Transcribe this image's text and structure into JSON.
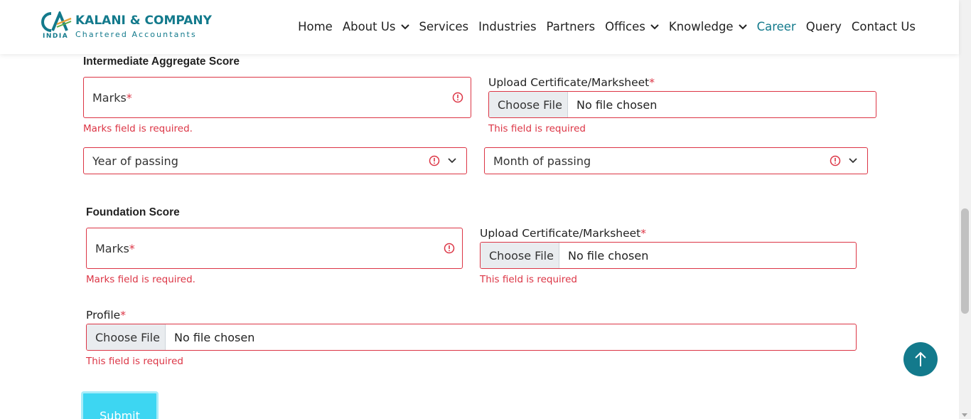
{
  "brand": {
    "company": "KALANI & COMPANY",
    "tagline": "Chartered Accountants",
    "country": "INDIA",
    "mark": "CA",
    "accent_color": "#137a8c"
  },
  "nav": {
    "items": [
      {
        "label": "Home",
        "dropdown": false,
        "active": false
      },
      {
        "label": "About Us",
        "dropdown": true,
        "active": false
      },
      {
        "label": "Services",
        "dropdown": false,
        "active": false
      },
      {
        "label": "Industries",
        "dropdown": false,
        "active": false
      },
      {
        "label": "Partners",
        "dropdown": false,
        "active": false
      },
      {
        "label": "Offices",
        "dropdown": true,
        "active": false
      },
      {
        "label": "Knowledge",
        "dropdown": true,
        "active": false
      },
      {
        "label": "Career",
        "dropdown": false,
        "active": true
      },
      {
        "label": "Query",
        "dropdown": false,
        "active": false
      },
      {
        "label": "Contact Us",
        "dropdown": false,
        "active": false
      }
    ]
  },
  "intermediate": {
    "title": "Intermediate Aggregate Score",
    "marks_placeholder": "Marks",
    "marks_error": "Marks field is required.",
    "upload_label": "Upload Certificate/Marksheet",
    "choose_file": "Choose File",
    "file_status": "No file chosen",
    "upload_error": "This field is required",
    "year_placeholder": "Year of passing",
    "month_placeholder": "Month of passing"
  },
  "foundation": {
    "title": "Foundation Score",
    "marks_placeholder": "Marks",
    "marks_error": "Marks field is required.",
    "upload_label": "Upload Certificate/Marksheet",
    "choose_file": "Choose File",
    "file_status": "No file chosen",
    "upload_error": "This field is required"
  },
  "profile": {
    "label": "Profile",
    "choose_file": "Choose File",
    "file_status": "No file chosen",
    "error": "This field is required"
  },
  "required_mark": "*",
  "submit_label": "Submit",
  "colors": {
    "error": "#dc3545",
    "submit": "#3dd6f2"
  }
}
